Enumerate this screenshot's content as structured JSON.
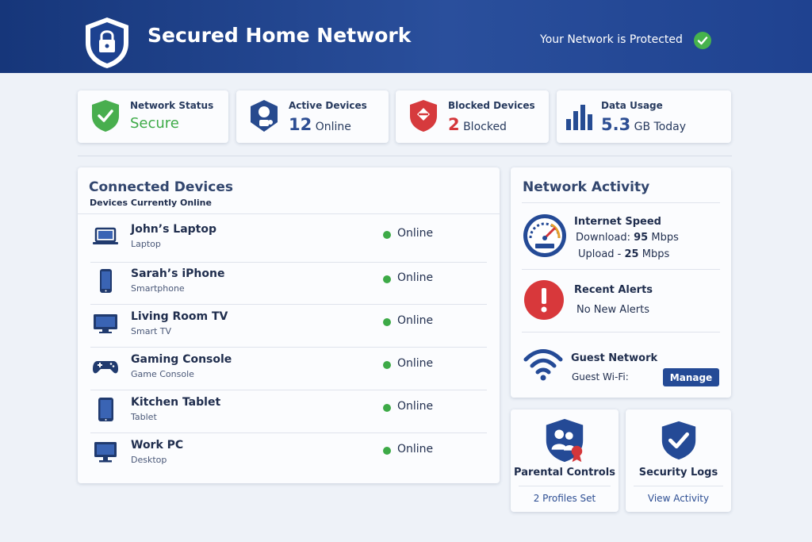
{
  "header": {
    "title": "Secured Home Network",
    "protection_status": "Your Network is Protected",
    "logo_icon": "shield-lock-icon",
    "status_icon": "check-circle-icon"
  },
  "stats": [
    {
      "label": "Network Status",
      "value": "Secure",
      "icon": "shield-check-icon",
      "color": "#3daa47"
    },
    {
      "label": "Active Devices",
      "number": "12",
      "unit": "Online",
      "icon": "devices-icon"
    },
    {
      "label": "Blocked Devices",
      "number": "2",
      "unit": "Blocked",
      "icon": "shield-block-icon",
      "color": "#d4363a"
    },
    {
      "label": "Data Usage",
      "number": "5.3",
      "unit": "GB Today",
      "icon": "bar-chart-icon"
    }
  ],
  "devices_panel": {
    "title": "Connected Devices",
    "subtitle": "Devices Currently Online",
    "devices": [
      {
        "name": "John’s Laptop",
        "type": "Laptop",
        "status": "Online",
        "icon": "laptop-icon"
      },
      {
        "name": "Sarah’s iPhone",
        "type": "Smartphone",
        "status": "Online",
        "icon": "smartphone-icon"
      },
      {
        "name": "Living Room TV",
        "type": "Smart TV",
        "status": "Online",
        "icon": "tv-icon"
      },
      {
        "name": "Gaming Console",
        "type": "Game Console",
        "status": "Online",
        "icon": "gamepad-icon"
      },
      {
        "name": "Kitchen Tablet",
        "type": "Tablet",
        "status": "Online",
        "icon": "tablet-icon"
      },
      {
        "name": "Work PC",
        "type": "Desktop",
        "status": "Online",
        "icon": "desktop-icon"
      }
    ]
  },
  "activity": {
    "title": "Network Activity",
    "speed": {
      "title": "Internet Speed",
      "download_label": "Download:",
      "download_value": "95",
      "upload_label": "Upload -",
      "upload_value": "25",
      "unit": "Mbps",
      "icon": "speedometer-icon"
    },
    "alerts": {
      "title": "Recent Alerts",
      "text": "No New Alerts",
      "icon": "alert-icon"
    },
    "guest": {
      "title": "Guest Network",
      "text": "Guest Wi-Fi:",
      "button": "Manage",
      "icon": "wifi-icon"
    }
  },
  "parental": {
    "title": "Parental Controls",
    "link": "2 Profiles Set",
    "icon": "family-shield-icon"
  },
  "security": {
    "title": "Security Logs",
    "link": "View Activity",
    "icon": "shield-check-icon"
  },
  "colors": {
    "brand": "#1f4290",
    "accent": "#244a96",
    "online": "#3daa47",
    "danger": "#d4363a"
  }
}
